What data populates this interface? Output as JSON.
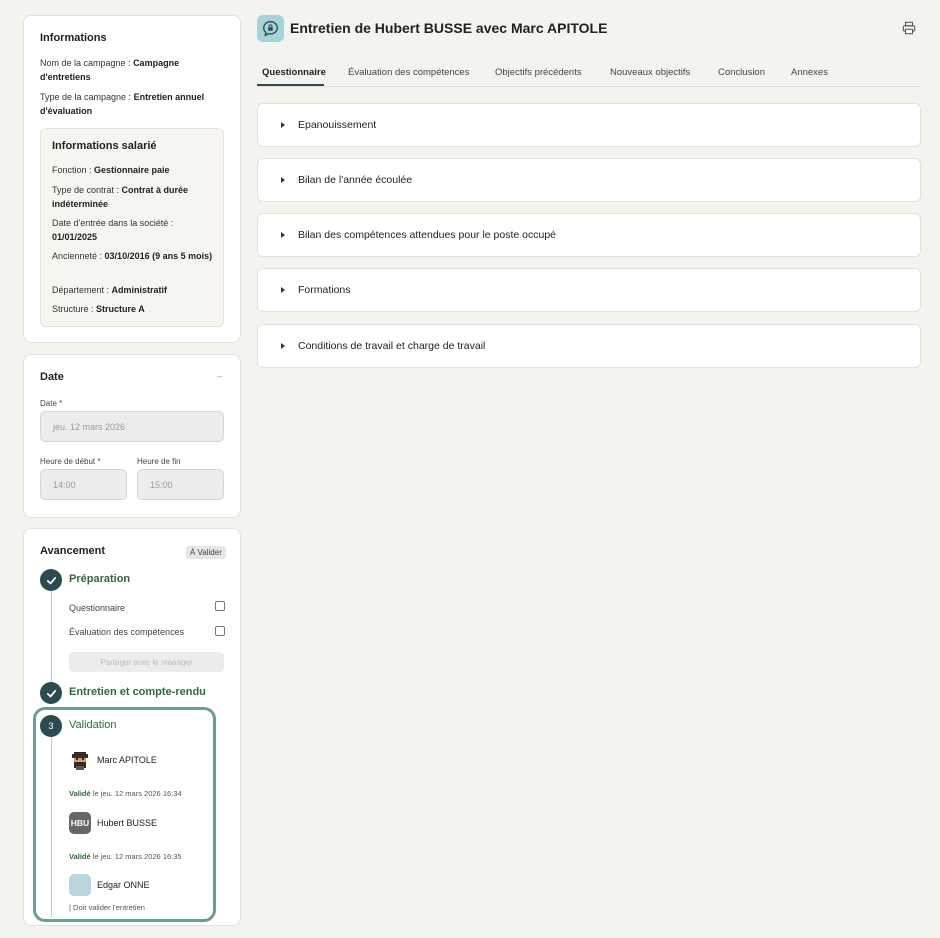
{
  "informations": {
    "title": "Informations",
    "campaign_name_label": "Nom de la campagne : ",
    "campaign_name_value": "Campagne d'entretiens",
    "campaign_type_label": "Type de la campagne : ",
    "campaign_type_value": "Entretien annuel d'évaluation",
    "employee": {
      "title": "Informations salarié",
      "function_label": "Fonction : ",
      "function_value": "Gestionnaire paie",
      "contract_label": "Type de contrat : ",
      "contract_value": "Contrat à durée indéterminée",
      "entry_label": "Date d'entrée dans la société : ",
      "entry_value": "01/01/2025",
      "seniority_label": "Ancienneté : ",
      "seniority_value": "03/10/2016 (9 ans 5 mois)",
      "department_label": "Département : ",
      "department_value": "Administratif",
      "structure_label": "Structure : ",
      "structure_value": "Structure A"
    }
  },
  "date_card": {
    "title": "Date",
    "collapse_symbol": "–",
    "date_label": "Date *",
    "date_value": "jeu. 12 mars 2026",
    "start_label": "Heure de début *",
    "start_value": "14:00",
    "end_label": "Heure de fin",
    "end_value": "15:00"
  },
  "progress": {
    "title": "Avancement",
    "badge": "À Valider",
    "step1": {
      "title": "Préparation",
      "sub1": "Questionnaire",
      "sub2": "Évaluation des compétences",
      "share_button": "Partager avec le manager"
    },
    "step2": {
      "title": "Entretien et compte-rendu"
    },
    "step3": {
      "number": "3",
      "title": "Validation",
      "validators": [
        {
          "name": "Marc APITOLE",
          "status": "Validé",
          "date": " le jeu. 12 mars 2026 16:34"
        },
        {
          "name": "Hubert BUSSE",
          "initials": "HBU",
          "status": "Validé",
          "date": " le jeu. 12 mars 2026 16:35"
        },
        {
          "name": "Edgar ONNE",
          "pending": "| Doit valider l'entretien"
        }
      ]
    }
  },
  "header": {
    "title": "Entretien de Hubert BUSSE avec Marc APITOLE"
  },
  "tabs": [
    "Questionnaire",
    "Évaluation des compétences",
    "Objectifs précédents",
    "Nouveaux objectifs",
    "Conclusion",
    "Annexes"
  ],
  "sections": [
    "Epanouissement",
    "Bilan de l'année écoulée",
    "Bilan des compétences attendues pour le poste occupé",
    "Formations",
    "Conditions de travail et charge de travail"
  ],
  "colors": {
    "accent": "#2b4a52",
    "success": "#2f6b3a",
    "highlight_border": "#6f9b90",
    "header_icon_bg": "#a9d1d8"
  }
}
